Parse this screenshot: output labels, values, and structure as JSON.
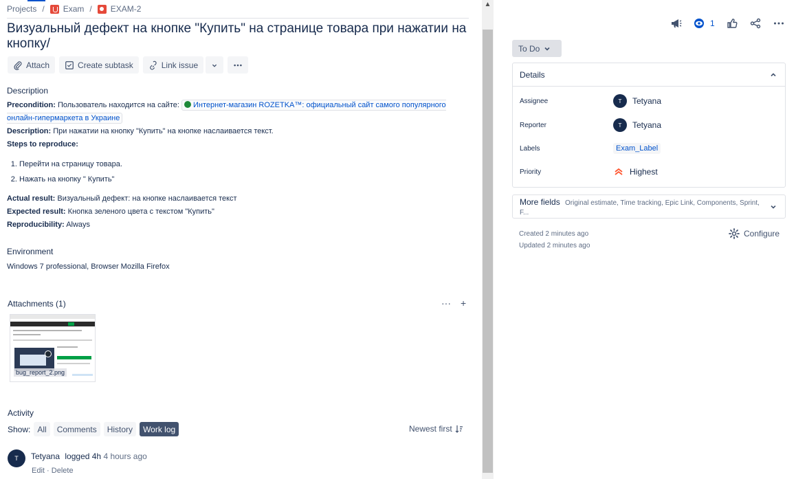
{
  "breadcrumb": {
    "projects": "Projects",
    "sep": "/",
    "project": "Exam",
    "issue_key": "EXAM-2"
  },
  "issue": {
    "title": "Визуальный дефект на кнопке \"Купить\" на странице товара при нажатии на кнопку/"
  },
  "toolbar": {
    "attach": "Attach",
    "create_subtask": "Create subtask",
    "link_issue": "Link issue"
  },
  "description": {
    "heading": "Description",
    "precondition_label": "Precondition:",
    "precondition_text": "Пользователь находится на сайте:",
    "link_text": "Интернет-магазин ROZETKA™: официальный сайт самого популярного онлайн-гипермаркета в Украине",
    "desc_label": "Description:",
    "desc_text": "При нажатии на кнопку \"Купить\" на кнопке наслаивается текст.",
    "steps_label": "Steps to reproduce:",
    "steps": [
      "Перейти на страницу товара.",
      "Нажать на кнопку \" Купить\""
    ],
    "actual_label": "Actual result:",
    "actual_text": "Визуальный дефект: на кнопке наслаивается текст",
    "expected_label": "Expected result:",
    "expected_text": "Кнопка зеленого цвета с текстом \"Купить\"",
    "repro_label": "Reproducibility:",
    "repro_text": "Always"
  },
  "environment": {
    "heading": "Environment",
    "text": "Windows 7 professional, Browser Mozilla Firefox"
  },
  "attachments": {
    "heading": "Attachments (1)",
    "file_name": "bug_report_2.png"
  },
  "activity": {
    "heading": "Activity",
    "show_label": "Show:",
    "filters": [
      "All",
      "Comments",
      "History",
      "Work log"
    ],
    "selected_filter": "Work log",
    "sort_label": "Newest first",
    "log": {
      "avatar": "T",
      "user": "Tetyana",
      "action": "logged 4h",
      "time": "4 hours ago",
      "edit": "Edit",
      "dot": "·",
      "delete": "Delete"
    }
  },
  "header_actions": {
    "watch_count": "1"
  },
  "status": {
    "label": "To Do"
  },
  "details": {
    "heading": "Details",
    "assignee_label": "Assignee",
    "assignee": "Tetyana",
    "assignee_avatar": "T",
    "reporter_label": "Reporter",
    "reporter": "Tetyana",
    "reporter_avatar": "T",
    "labels_label": "Labels",
    "label_value": "Exam_Label",
    "priority_label": "Priority",
    "priority": "Highest"
  },
  "more_fields": {
    "title": "More fields",
    "summary": "Original estimate, Time tracking, Epic Link, Components, Sprint, F..."
  },
  "meta": {
    "created": "Created 2 minutes ago",
    "updated": "Updated 2 minutes ago"
  },
  "configure": {
    "label": "Configure"
  },
  "colors": {
    "accent": "#0052cc",
    "priority_highest": "#ff5630",
    "text": "#172b4d"
  }
}
